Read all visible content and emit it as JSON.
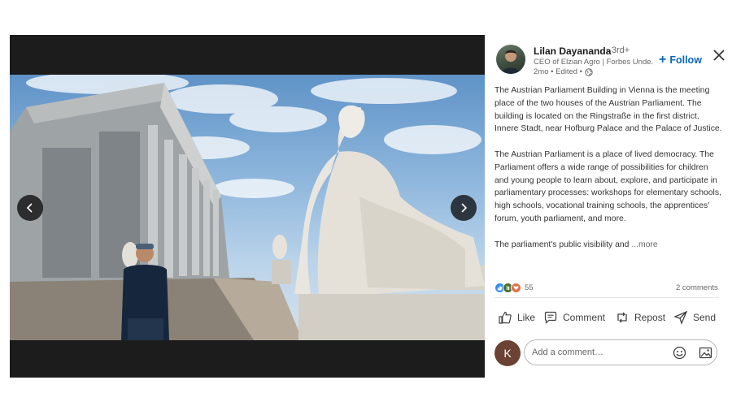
{
  "author": {
    "name": "Lilan Dayananda",
    "degree": "• 3rd+",
    "headline": "CEO of Elzian Agro | Forbes Unde...",
    "meta": "2mo • Edited •",
    "follow_label": "Follow"
  },
  "post": {
    "paragraphs": [
      "The Austrian Parliament Building in Vienna is the meeting place of the two houses of the Austrian Parliament. The building is located on the Ringstraße in the first district, Innere Stadt, near Hofburg Palace and the Palace of Justice.",
      "The Austrian Parliament is a place of lived democracy. The Parliament offers a wide range of possibilities for children and young people to learn about, explore, and participate in parliamentary processes: workshops for elementary schools, high schools, vocational training schools, the apprentices' forum, youth parliament, and more."
    ],
    "truncated": "The parliament's public visibility and ",
    "more_label": "...more"
  },
  "social": {
    "reaction_count": "55",
    "comments_label": "2 comments"
  },
  "actions": {
    "like": "Like",
    "comment": "Comment",
    "repost": "Repost",
    "send": "Send"
  },
  "comment_box": {
    "avatar_initial": "K",
    "placeholder": "Add a comment…"
  },
  "icons": [
    "chevron-left-icon",
    "chevron-right-icon",
    "close-icon",
    "globe-icon",
    "like-icon",
    "comment-icon",
    "repost-icon",
    "send-icon",
    "emoji-icon",
    "image-icon"
  ],
  "colors": {
    "accent": "#0a66c2",
    "like_blue": "#378fe9",
    "celebrate_green": "#44712e",
    "love_red": "#df704d"
  }
}
